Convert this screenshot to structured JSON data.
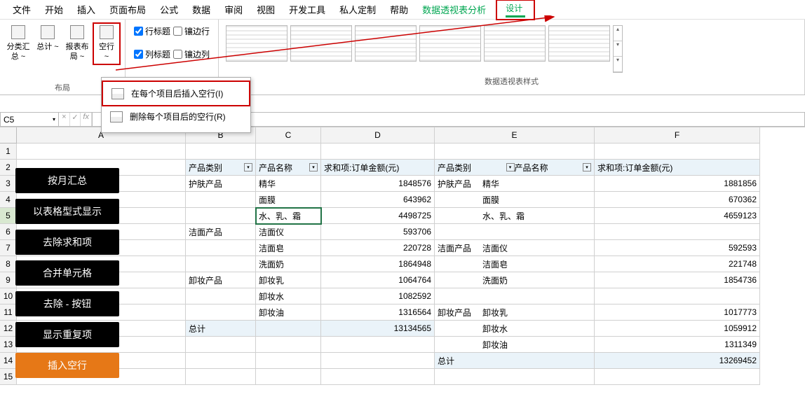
{
  "menu": {
    "tabs": [
      "文件",
      "开始",
      "插入",
      "页面布局",
      "公式",
      "数据",
      "审阅",
      "视图",
      "开发工具",
      "私人定制",
      "帮助"
    ],
    "pivot_analyze": "数据透视表分析",
    "design": "设计"
  },
  "ribbon": {
    "layout_group": "布局",
    "btns": {
      "subtotal": "分类汇\n总 ~",
      "grandtotal": "总计\n~",
      "report_layout": "报表布\n局 ~",
      "blank_rows": "空行\n~"
    },
    "checks": {
      "row_headers": "行标题",
      "banded_rows": "镶边行",
      "col_headers": "列标题",
      "banded_cols": "镶边列"
    },
    "styles_group": "数据透视表样式"
  },
  "dropdown": {
    "insert": "在每个项目后插入空行(I)",
    "remove": "删除每个项目后的空行(R)"
  },
  "namebox": "C5",
  "col_headers": [
    "A",
    "B",
    "C",
    "D",
    "E",
    "F"
  ],
  "callouts": [
    "按月汇总",
    "以表格型式显示",
    "去除求和项",
    "合并单元格",
    "去除 - 按钮",
    "显示重复项",
    "插入空行"
  ],
  "pivot_headers": {
    "cat": "产品类别",
    "name": "产品名称",
    "amount": "求和项:订单金额(元)",
    "total": "总计"
  },
  "pivot1": {
    "rows": [
      {
        "cat": "护肤产品",
        "name": "精华",
        "val": "1848576"
      },
      {
        "cat": "",
        "name": "面膜",
        "val": "643962"
      },
      {
        "cat": "",
        "name": "水、乳、霜",
        "val": "4498725",
        "sel": true
      },
      {
        "cat": "洁面产品",
        "name": "洁面仪",
        "val": "593706"
      },
      {
        "cat": "",
        "name": "洁面皂",
        "val": "220728"
      },
      {
        "cat": "",
        "name": "洗面奶",
        "val": "1864948"
      },
      {
        "cat": "卸妆产品",
        "name": "卸妆乳",
        "val": "1064764"
      },
      {
        "cat": "",
        "name": "卸妆水",
        "val": "1082592"
      },
      {
        "cat": "",
        "name": "卸妆油",
        "val": "1316564"
      }
    ],
    "total": "13134565"
  },
  "pivot2": {
    "rows": [
      {
        "cat": "护肤产品",
        "name": "精华",
        "val": "1881856"
      },
      {
        "cat": "",
        "name": "面膜",
        "val": "670362"
      },
      {
        "cat": "",
        "name": "水、乳、霜",
        "val": "4659123"
      },
      {
        "cat": "洁面产品",
        "name": "洁面仪",
        "val": "592593"
      },
      {
        "cat": "",
        "name": "洁面皂",
        "val": "221748"
      },
      {
        "cat": "",
        "name": "洗面奶",
        "val": "1854736"
      },
      {
        "cat": "卸妆产品",
        "name": "卸妆乳",
        "val": "1017773"
      },
      {
        "cat": "",
        "name": "卸妆水",
        "val": "1059912"
      },
      {
        "cat": "",
        "name": "卸妆油",
        "val": "1311349"
      }
    ],
    "total": "13269452"
  }
}
